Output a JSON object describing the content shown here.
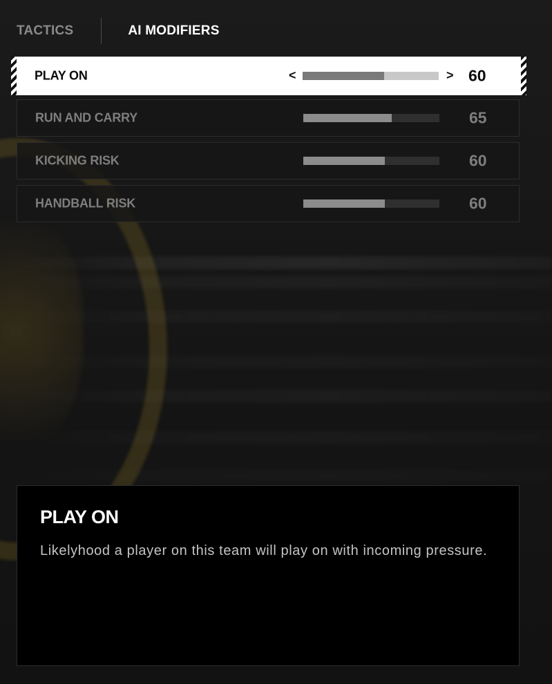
{
  "tabs": [
    {
      "label": "TACTICS",
      "active": false
    },
    {
      "label": "AI MODIFIERS",
      "active": true
    }
  ],
  "selected_arrows": {
    "left": "<",
    "right": ">"
  },
  "modifiers": [
    {
      "label": "PLAY ON",
      "value": "60",
      "level": 60,
      "selected": true
    },
    {
      "label": "RUN AND CARRY",
      "value": "65",
      "level": 65,
      "selected": false
    },
    {
      "label": "KICKING RISK",
      "value": "60",
      "level": 60,
      "selected": false
    },
    {
      "label": "HANDBALL RISK",
      "value": "60",
      "level": 60,
      "selected": false
    }
  ],
  "description": {
    "title": "PLAY ON",
    "text": "Likelyhood a player on this team will play on with incoming pressure."
  },
  "colors": {
    "selected_background": "#ffffff",
    "panel_background": "#000000",
    "accent_emblem": "#c8a028"
  }
}
